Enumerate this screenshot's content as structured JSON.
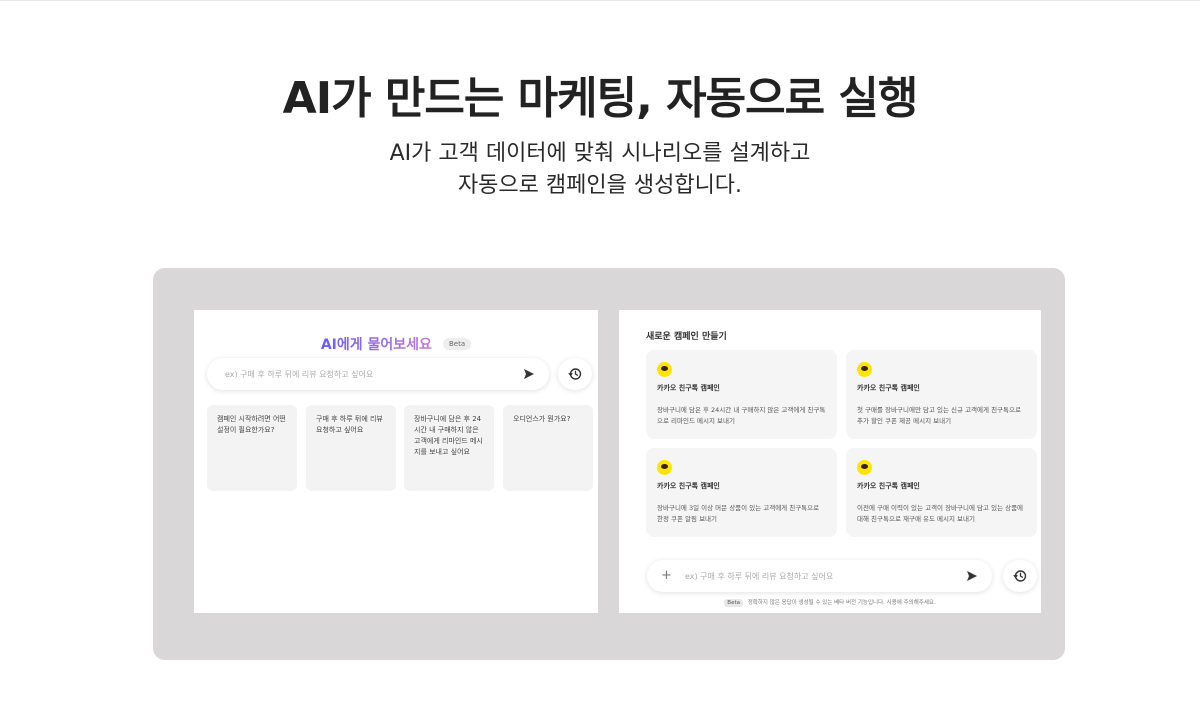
{
  "hero": {
    "title": "AI가 만드는 마케팅, 자동으로 실행",
    "subtitle_line1": "AI가 고객 데이터에 맞춰 시나리오를 설계하고",
    "subtitle_line2": "자동으로 캠페인을 생성합니다."
  },
  "ask_panel": {
    "title": "AI에게 물어보세요",
    "beta": "Beta",
    "search_placeholder": "ex) 구매 후 하루 뒤에 리뷰 요청하고 싶어요",
    "suggestions": [
      "캠페인 시작하려면 어떤 설정이 필요한가요?",
      "구매 후 하루 뒤에 리뷰 요청하고 싶어요",
      "장바구니에 담은 후 24시간 내 구매하지 않은 고객에게 리마인드 메시지를 보내고 싶어요",
      "오디언스가 뭔가요?"
    ]
  },
  "campaign_panel": {
    "title": "새로운 캠페인 만들기",
    "cards": [
      {
        "title": "카카오 친구톡 캠페인",
        "desc": "장바구니에 담은 후 24시간 내 구매하지 않은 고객에게 친구톡으로 리마인드 메시지 보내기"
      },
      {
        "title": "카카오 친구톡 캠페인",
        "desc": "첫 구매를 장바구니에만 담고 있는 신규 고객에게 친구톡으로 추가 할인 쿠폰 제공 메시지 보내기"
      },
      {
        "title": "카카오 친구톡 캠페인",
        "desc": "장바구니에 3일 이상 머문 상품이 있는 고객에게 친구톡으로 한정 쿠폰 알림 보내기"
      },
      {
        "title": "카카오 친구톡 캠페인",
        "desc": "이전에 구매 이력이 있는 고객이 장바구니에 담고 있는 상품에 대해 친구톡으로 재구매 유도 메시지 보내기"
      }
    ],
    "input_placeholder": "ex) 구매 후 하루 뒤에 리뷰 요청하고 싶어요",
    "disclaimer_badge": "Beta",
    "disclaimer": "정확하지 않은 응답이 생성될 수 있는 베타 버전 기능입니다. 사용에 주의해주세요."
  },
  "colors": {
    "frame_bg": "#d9d7d8",
    "kakao_yellow": "#fee500",
    "accent_gradient_start": "#6a5cf5",
    "accent_gradient_end": "#c07bd0"
  },
  "icons": {
    "send": "send-icon",
    "history": "history-icon",
    "plus": "plus-icon",
    "kakao": "kakao-chat-icon"
  }
}
